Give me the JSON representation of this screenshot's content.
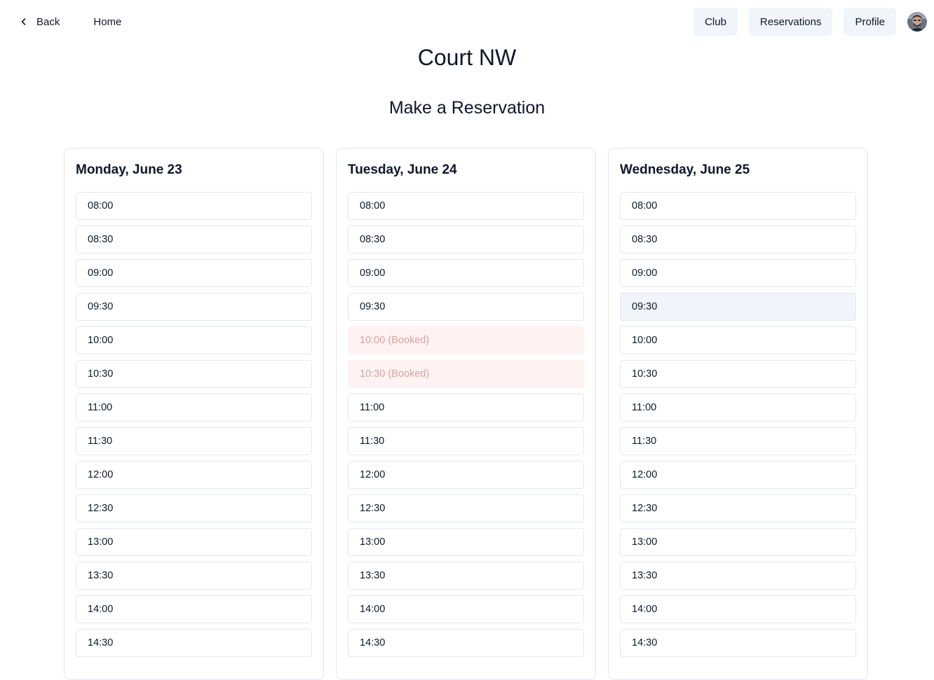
{
  "nav": {
    "back_label": "Back",
    "home_label": "Home",
    "buttons": [
      "Club",
      "Reservations",
      "Profile"
    ]
  },
  "page": {
    "title": "Court NW",
    "section_title": "Make a Reservation"
  },
  "colors": {
    "booked_bg": "#fef2f2",
    "booked_text": "#d9a3a3",
    "hover_bg": "#f1f5f9",
    "button_bg": "#f1f5f9"
  },
  "days": [
    {
      "title": "Monday, June 23",
      "slots": [
        {
          "label": "08:00",
          "state": "available"
        },
        {
          "label": "08:30",
          "state": "available"
        },
        {
          "label": "09:00",
          "state": "available"
        },
        {
          "label": "09:30",
          "state": "available"
        },
        {
          "label": "10:00",
          "state": "available"
        },
        {
          "label": "10:30",
          "state": "available"
        },
        {
          "label": "11:00",
          "state": "available"
        },
        {
          "label": "11:30",
          "state": "available"
        },
        {
          "label": "12:00",
          "state": "available"
        },
        {
          "label": "12:30",
          "state": "available"
        },
        {
          "label": "13:00",
          "state": "available"
        },
        {
          "label": "13:30",
          "state": "available"
        },
        {
          "label": "14:00",
          "state": "available"
        },
        {
          "label": "14:30",
          "state": "available"
        }
      ]
    },
    {
      "title": "Tuesday, June 24",
      "slots": [
        {
          "label": "08:00",
          "state": "available"
        },
        {
          "label": "08:30",
          "state": "available"
        },
        {
          "label": "09:00",
          "state": "available"
        },
        {
          "label": "09:30",
          "state": "available"
        },
        {
          "label": "10:00 (Booked)",
          "state": "booked"
        },
        {
          "label": "10:30 (Booked)",
          "state": "booked"
        },
        {
          "label": "11:00",
          "state": "available"
        },
        {
          "label": "11:30",
          "state": "available"
        },
        {
          "label": "12:00",
          "state": "available"
        },
        {
          "label": "12:30",
          "state": "available"
        },
        {
          "label": "13:00",
          "state": "available"
        },
        {
          "label": "13:30",
          "state": "available"
        },
        {
          "label": "14:00",
          "state": "available"
        },
        {
          "label": "14:30",
          "state": "available"
        }
      ]
    },
    {
      "title": "Wednesday, June 25",
      "slots": [
        {
          "label": "08:00",
          "state": "available"
        },
        {
          "label": "08:30",
          "state": "available"
        },
        {
          "label": "09:00",
          "state": "available"
        },
        {
          "label": "09:30",
          "state": "hover"
        },
        {
          "label": "10:00",
          "state": "available"
        },
        {
          "label": "10:30",
          "state": "available"
        },
        {
          "label": "11:00",
          "state": "available"
        },
        {
          "label": "11:30",
          "state": "available"
        },
        {
          "label": "12:00",
          "state": "available"
        },
        {
          "label": "12:30",
          "state": "available"
        },
        {
          "label": "13:00",
          "state": "available"
        },
        {
          "label": "13:30",
          "state": "available"
        },
        {
          "label": "14:00",
          "state": "available"
        },
        {
          "label": "14:30",
          "state": "available"
        }
      ]
    }
  ]
}
